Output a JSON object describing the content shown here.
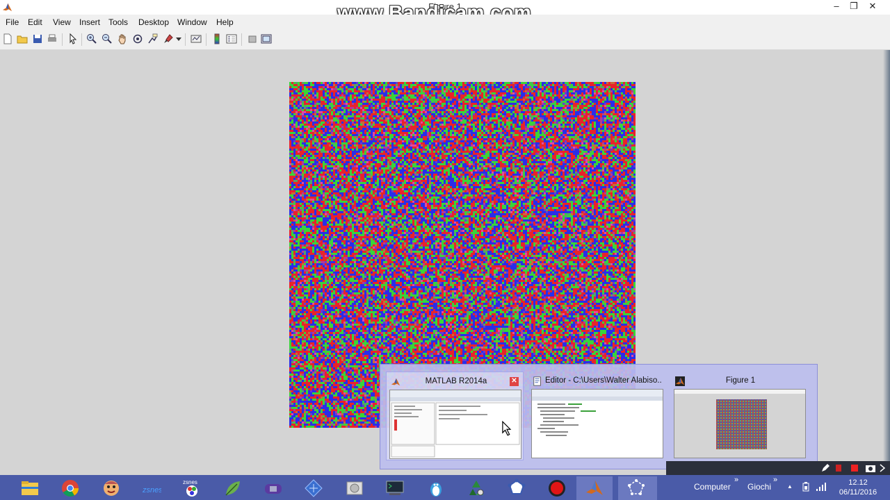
{
  "window": {
    "title": "Figure 1",
    "watermark": "www.Bandicam.com",
    "controls": {
      "minimize": "–",
      "restore": "❐",
      "close": "✕"
    }
  },
  "menubar": [
    "File",
    "Edit",
    "View",
    "Insert",
    "Tools",
    "Desktop",
    "Window",
    "Help"
  ],
  "toolbar": {
    "icons": [
      "new-figure-icon",
      "open-file-icon",
      "save-icon",
      "print-icon",
      "edit-plot-icon",
      "zoom-in-icon",
      "zoom-out-icon",
      "pan-icon",
      "rotate-3d-icon",
      "data-cursor-icon",
      "brush-icon",
      "link-plot-icon",
      "colorbar-icon",
      "legend-icon",
      "hide-plot-tools-icon",
      "show-plot-tools-icon"
    ]
  },
  "figure": {
    "description_colors": [
      "#e8232a",
      "#2a2ee8",
      "#39d43a",
      "#b13a9a",
      "#c86a3a",
      "#6a3ad0",
      "#58a06a",
      "#e04aa0"
    ]
  },
  "taskbar_preview": {
    "items": [
      {
        "title": "MATLAB R2014a",
        "icon": "matlab-icon",
        "close": "✕"
      },
      {
        "title": "Editor - C:\\Users\\Walter Alabiso...",
        "icon": "editor-icon"
      },
      {
        "title": "Figure 1",
        "icon": "matlab-icon"
      }
    ]
  },
  "taskbar": {
    "apps": [
      "file-explorer-icon",
      "chrome-icon",
      "game-face-icon",
      "zsnes-icon",
      "zsnes-icon",
      "leaf-app-icon",
      "gameboy-icon",
      "diamond-app-icon",
      "drive-icon",
      "terminal-icon",
      "penguin-app-icon",
      "recycle-icon",
      "network-app-icon",
      "bandicam-record-icon",
      "matlab-icon",
      "matlab-figure-icon"
    ],
    "toolbars": [
      "Computer",
      "Giochi"
    ],
    "toolbar_chevron": "»",
    "tray_arrow": "▲",
    "time": "12.12",
    "date": "06/11/2016"
  }
}
